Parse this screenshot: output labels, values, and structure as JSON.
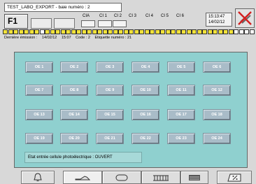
{
  "header": {
    "title": "TEST_LABO_EXPORT  -  baie numéro : 2",
    "function_key": "F1",
    "cells": [
      "CIA",
      "CI 1",
      "CI 2",
      "CI 3",
      "CI 4",
      "CI 5",
      "CI 6"
    ],
    "time": "15:13:47",
    "date": "14/02/12"
  },
  "led_strip": [
    "y",
    "y",
    "y",
    "y",
    "y",
    "y",
    "y",
    "w",
    "y",
    "y",
    "y",
    "y",
    "y",
    "y",
    "y",
    "y",
    "y",
    "y",
    "y",
    "y",
    "y",
    "y",
    "y",
    "y",
    "y",
    "y",
    "y",
    "y",
    "y",
    "y",
    "y",
    "y",
    "y",
    "y",
    "y",
    "y",
    "y",
    "y",
    "y",
    "y",
    "y",
    "y",
    "y",
    "y",
    "w",
    "w",
    "w",
    "w"
  ],
  "emission": {
    "label": "Dernière émission :",
    "date": "14/02/12",
    "time": "15:07",
    "code": "Code : 2",
    "label_number": "Etiquette numéro : 21"
  },
  "oe_buttons": [
    "OE 1",
    "OE 2",
    "OE 3",
    "OE 4",
    "OE 5",
    "OE 6",
    "OE 7",
    "OE 8",
    "OE 9",
    "OE 10",
    "OE 11",
    "OE 12",
    "OE 13",
    "OE 14",
    "OE 15",
    "OE 16",
    "OE 17",
    "OE 18",
    "OE 19",
    "OE 20",
    "OE 21",
    "OE 22",
    "OE 23",
    "OE 24"
  ],
  "cell_state": "Etat entrée cellule photoélectrique :   OUVERT",
  "toolbar": [
    "bell-icon",
    "shoe-icon",
    "rounded-rect-icon",
    "rack-icon",
    "list-icon",
    "percent-icon"
  ],
  "colors": {
    "panel": "#8fd0cf",
    "button": "#a9bcc8",
    "led_on": "#f2e23a",
    "alarm_red": "#d42020"
  }
}
